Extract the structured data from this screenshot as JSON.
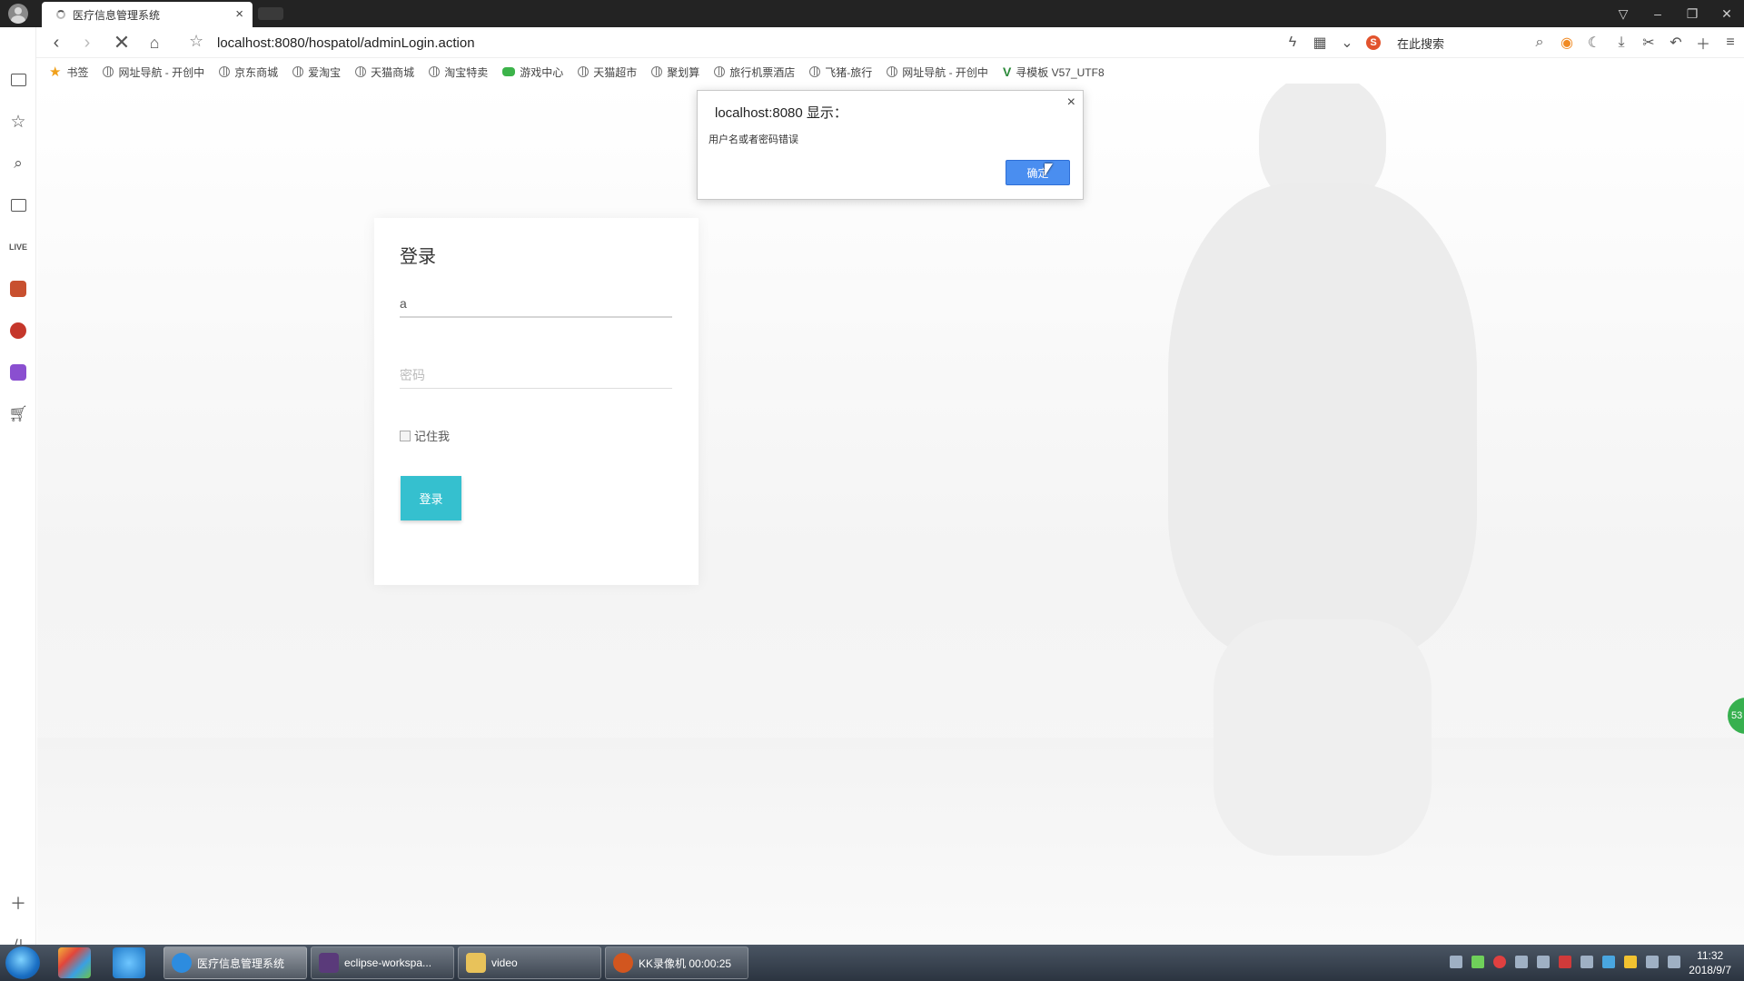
{
  "browser": {
    "tab_title": "医疗信息管理系统",
    "tab_close": "×",
    "url": "localhost:8080/hospatol/adminLogin.action",
    "search_placeholder": "在此搜索",
    "window_controls": [
      "▽",
      "–",
      "❐",
      "✕"
    ]
  },
  "bookmarks": [
    {
      "label": "书签",
      "icon": "star-icon"
    },
    {
      "label": "网址导航 - 开创中",
      "icon": "globe-icon"
    },
    {
      "label": "京东商城",
      "icon": "globe-icon"
    },
    {
      "label": "爱淘宝",
      "icon": "globe-icon"
    },
    {
      "label": "天猫商城",
      "icon": "globe-icon"
    },
    {
      "label": "淘宝特卖",
      "icon": "globe-icon"
    },
    {
      "label": "游戏中心",
      "icon": "gamepad-icon"
    },
    {
      "label": "天猫超市",
      "icon": "globe-icon"
    },
    {
      "label": "聚划算",
      "icon": "globe-icon"
    },
    {
      "label": "旅行机票酒店",
      "icon": "globe-icon"
    },
    {
      "label": "飞猪-旅行",
      "icon": "globe-icon"
    },
    {
      "label": "网址导航 - 开创中",
      "icon": "globe-icon"
    },
    {
      "label": "寻模板 V57_UTF8",
      "icon": "v-logo-icon"
    }
  ],
  "login": {
    "title": "登录",
    "username_value": "a",
    "password_placeholder": "密码",
    "remember_label": "记住我",
    "submit_label": "登录"
  },
  "alert": {
    "title": "localhost:8080 显示：",
    "message": "用户名或者密码错误",
    "ok_label": "确定",
    "close": "×"
  },
  "side_ball_text": "53",
  "taskbar": {
    "tasks": [
      {
        "label": "医疗信息管理系统",
        "active": true
      },
      {
        "label": "eclipse-workspa...",
        "active": false
      },
      {
        "label": "video",
        "active": false
      },
      {
        "label": "KK录像机 00:00:25",
        "active": false
      }
    ],
    "time": "11:32",
    "date": "2018/9/7"
  }
}
